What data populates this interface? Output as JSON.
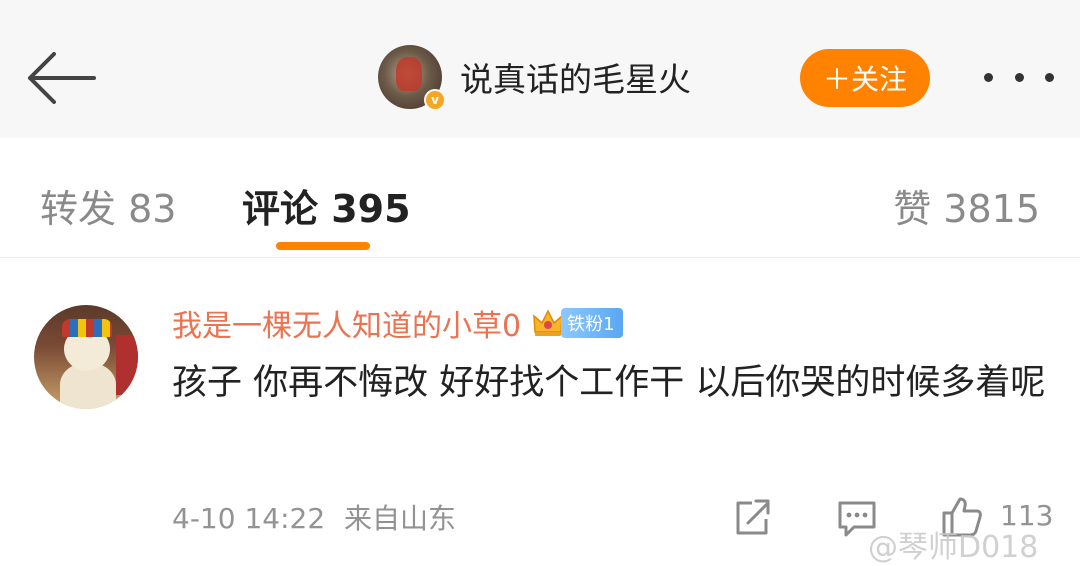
{
  "header": {
    "back_icon": "arrow-left-icon",
    "title": "说真话的毛星火",
    "verified_mark": "v",
    "follow_label": "＋关注",
    "more_icon": "more-dots-icon"
  },
  "tabs": [
    {
      "label": "转发 83"
    },
    {
      "label": "评论 395"
    },
    {
      "label": "赞 3815"
    }
  ],
  "active_tab": "评论 395",
  "comment": {
    "author": "我是一棵无人知道的小草0",
    "fan_badge": "铁粉1",
    "text": "孩子 你再不悔改 好好找个工作干  以后你哭的时候多着呢",
    "time": "4-10 14:22",
    "source": "来自山东",
    "like_count": "113"
  },
  "watermark": "@琴师D018",
  "colors": {
    "accent": "#ff8200",
    "author_name": "#eb7350",
    "muted": "#939393",
    "fan_badge": "#5aa7f2"
  }
}
